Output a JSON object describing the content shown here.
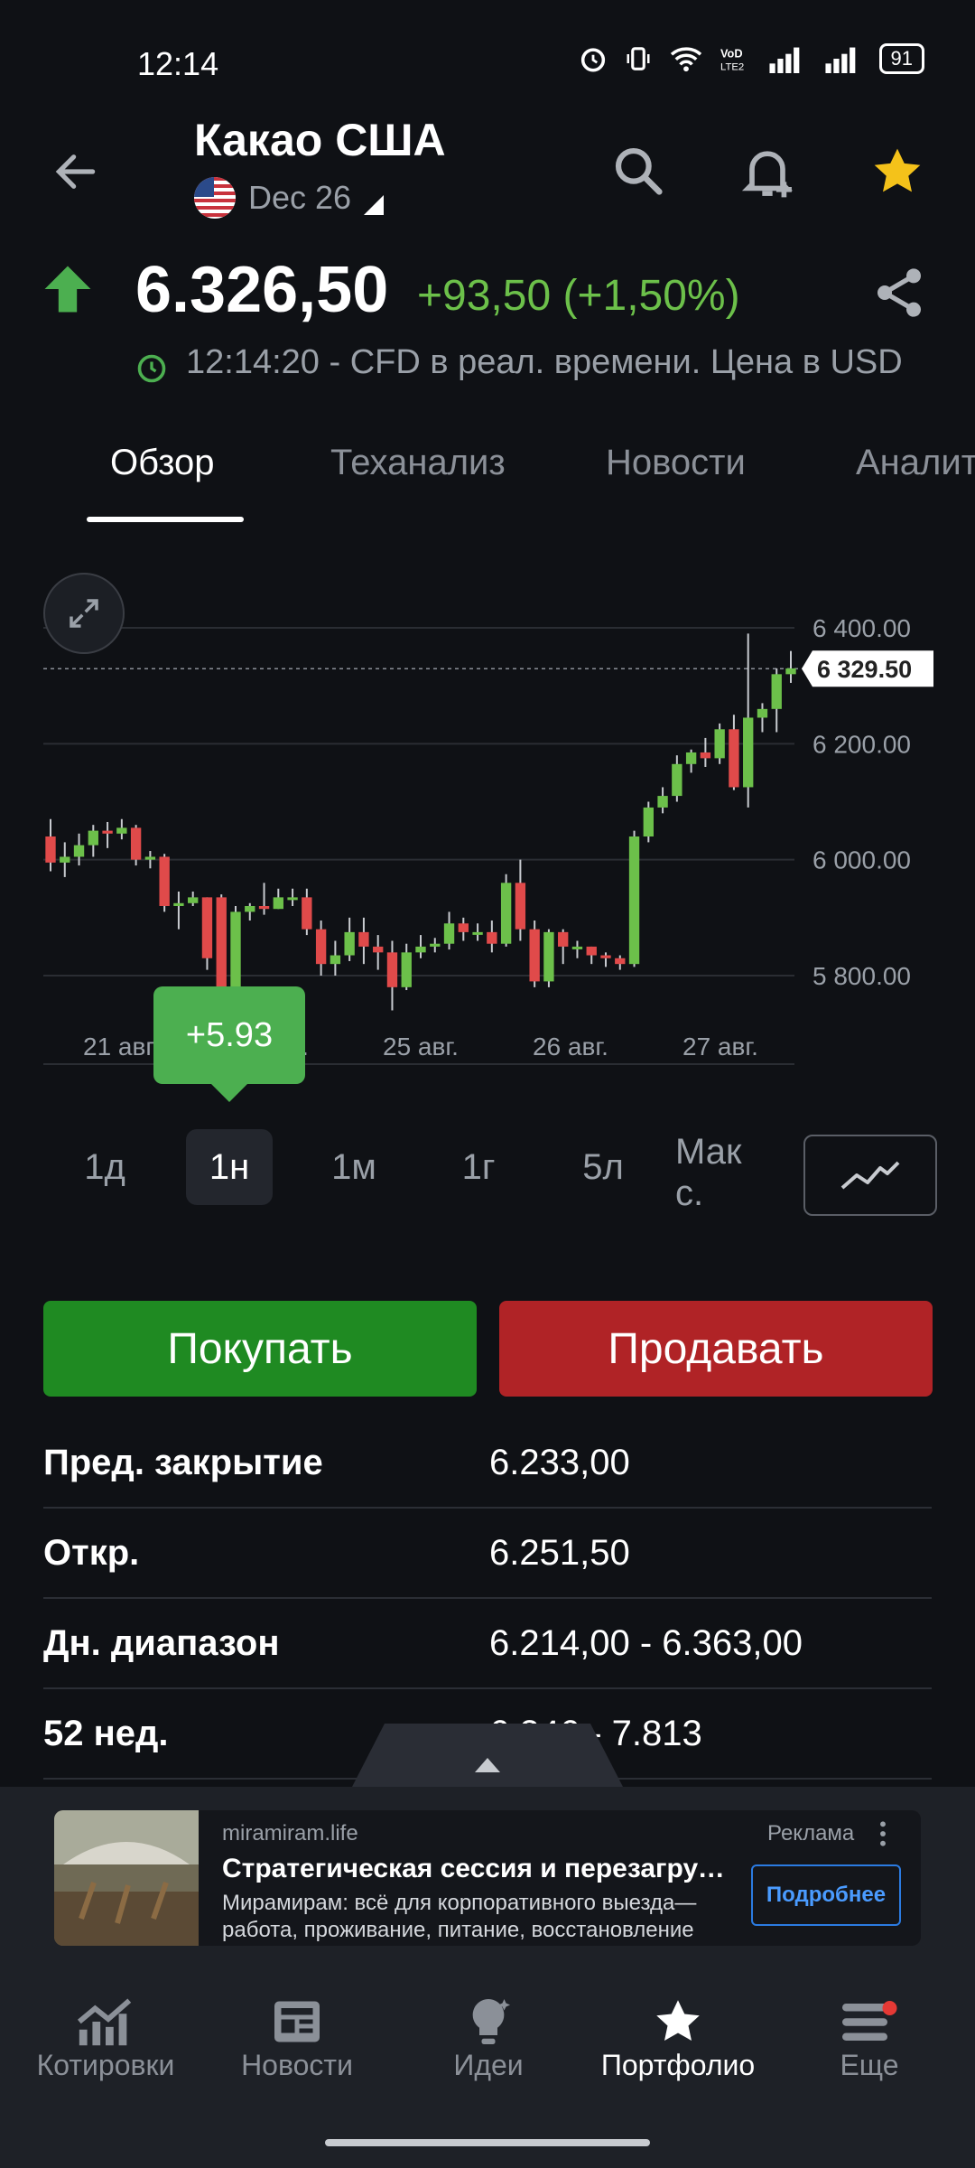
{
  "status": {
    "time": "12:14",
    "battery": "91"
  },
  "header": {
    "title": "Какао США",
    "contract": "Dec 26"
  },
  "quote": {
    "price": "6.326,50",
    "change": "+93,50 (+1,50%)",
    "timestamp": "12:14:20 - CFD в реал. времени. Цена в USD",
    "up_color": "#4caf50"
  },
  "tabs": [
    {
      "label": "Обзор"
    },
    {
      "label": "Теханализ"
    },
    {
      "label": "Новости"
    },
    {
      "label": "Аналит"
    }
  ],
  "chart_data": {
    "type": "candlestick",
    "y_ticks": [
      "6 400.00",
      "6 200.00",
      "6 000.00",
      "5 800.00"
    ],
    "ylim": [
      5700,
      6440
    ],
    "x_ticks": [
      "21 авг.",
      "22 авг.",
      "25 авг.",
      "26 авг.",
      "27 авг."
    ],
    "last_price_label": "6 329.50",
    "last_price": 6329.5,
    "tooltip": "+5.93",
    "up_color": "#6cc04a",
    "down_color": "#e04a4a",
    "candles": [
      [
        6040,
        5995,
        6070,
        5980
      ],
      [
        5995,
        6005,
        6030,
        5970
      ],
      [
        6005,
        6025,
        6045,
        5990
      ],
      [
        6025,
        6050,
        6060,
        6005
      ],
      [
        6050,
        6045,
        6065,
        6020
      ],
      [
        6045,
        6055,
        6070,
        6035
      ],
      [
        6055,
        6000,
        6060,
        5990
      ],
      [
        6000,
        6005,
        6015,
        5985
      ],
      [
        6005,
        5920,
        6010,
        5910
      ],
      [
        5920,
        5925,
        5945,
        5880
      ],
      [
        5925,
        5935,
        5945,
        5920
      ],
      [
        5935,
        5830,
        5935,
        5810
      ],
      [
        5935,
        5770,
        5940,
        5760
      ],
      [
        5770,
        5910,
        5920,
        5755
      ],
      [
        5910,
        5920,
        5925,
        5895
      ],
      [
        5920,
        5915,
        5960,
        5905
      ],
      [
        5915,
        5935,
        5950,
        5915
      ],
      [
        5935,
        5935,
        5950,
        5920
      ],
      [
        5935,
        5880,
        5950,
        5870
      ],
      [
        5880,
        5820,
        5895,
        5800
      ],
      [
        5820,
        5835,
        5860,
        5800
      ],
      [
        5835,
        5875,
        5900,
        5825
      ],
      [
        5875,
        5850,
        5900,
        5820
      ],
      [
        5850,
        5840,
        5870,
        5810
      ],
      [
        5840,
        5780,
        5860,
        5740
      ],
      [
        5780,
        5840,
        5855,
        5775
      ],
      [
        5840,
        5850,
        5870,
        5830
      ],
      [
        5850,
        5855,
        5865,
        5840
      ],
      [
        5855,
        5890,
        5910,
        5845
      ],
      [
        5890,
        5875,
        5900,
        5860
      ],
      [
        5875,
        5875,
        5890,
        5860
      ],
      [
        5875,
        5855,
        5895,
        5840
      ],
      [
        5855,
        5960,
        5975,
        5850
      ],
      [
        5960,
        5880,
        6000,
        5860
      ],
      [
        5880,
        5790,
        5895,
        5780
      ],
      [
        5790,
        5875,
        5880,
        5780
      ],
      [
        5875,
        5850,
        5880,
        5820
      ],
      [
        5850,
        5850,
        5860,
        5830
      ],
      [
        5850,
        5835,
        5850,
        5820
      ],
      [
        5835,
        5830,
        5840,
        5815
      ],
      [
        5830,
        5820,
        5835,
        5810
      ],
      [
        5820,
        6040,
        6050,
        5815
      ],
      [
        6040,
        6090,
        6100,
        6030
      ],
      [
        6090,
        6110,
        6125,
        6080
      ],
      [
        6110,
        6165,
        6180,
        6100
      ],
      [
        6165,
        6185,
        6190,
        6150
      ],
      [
        6185,
        6175,
        6210,
        6160
      ],
      [
        6175,
        6225,
        6235,
        6165
      ],
      [
        6225,
        6125,
        6250,
        6120
      ],
      [
        6125,
        6245,
        6390,
        6090
      ],
      [
        6245,
        6260,
        6270,
        6220
      ],
      [
        6260,
        6320,
        6330,
        6220
      ],
      [
        6320,
        6330,
        6360,
        6305
      ]
    ]
  },
  "periods": [
    "1д",
    "1н",
    "1м",
    "1г",
    "5л",
    "Мак\nс."
  ],
  "active_period": "1н",
  "actions": {
    "buy": "Покупать",
    "sell": "Продавать"
  },
  "stats": [
    {
      "label": "Пред. закрытие",
      "value": "6.233,00"
    },
    {
      "label": "Откр.",
      "value": "6.251,50"
    },
    {
      "label": "Дн. диапазон",
      "value": "6.214,00 - 6.363,00"
    },
    {
      "label": "52 нед.",
      "value": "6.246 - 7.813"
    }
  ],
  "ad": {
    "domain": "miramiram.life",
    "label": "Реклама",
    "title": "Стратегическая сессия и перезагрузк…",
    "body": "Мирамирам: всё для корпоративного выезда— работа, проживание, питание, восстановление",
    "cta": "Подробнее"
  },
  "nav": [
    {
      "label": "Котировки",
      "icon": "quotes-chart-icon"
    },
    {
      "label": "Новости",
      "icon": "news-icon"
    },
    {
      "label": "Идеи",
      "icon": "ideas-bulb-icon"
    },
    {
      "label": "Портфолио",
      "icon": "star-icon"
    },
    {
      "label": "Еще",
      "icon": "menu-icon"
    }
  ],
  "active_nav": "Портфолио"
}
